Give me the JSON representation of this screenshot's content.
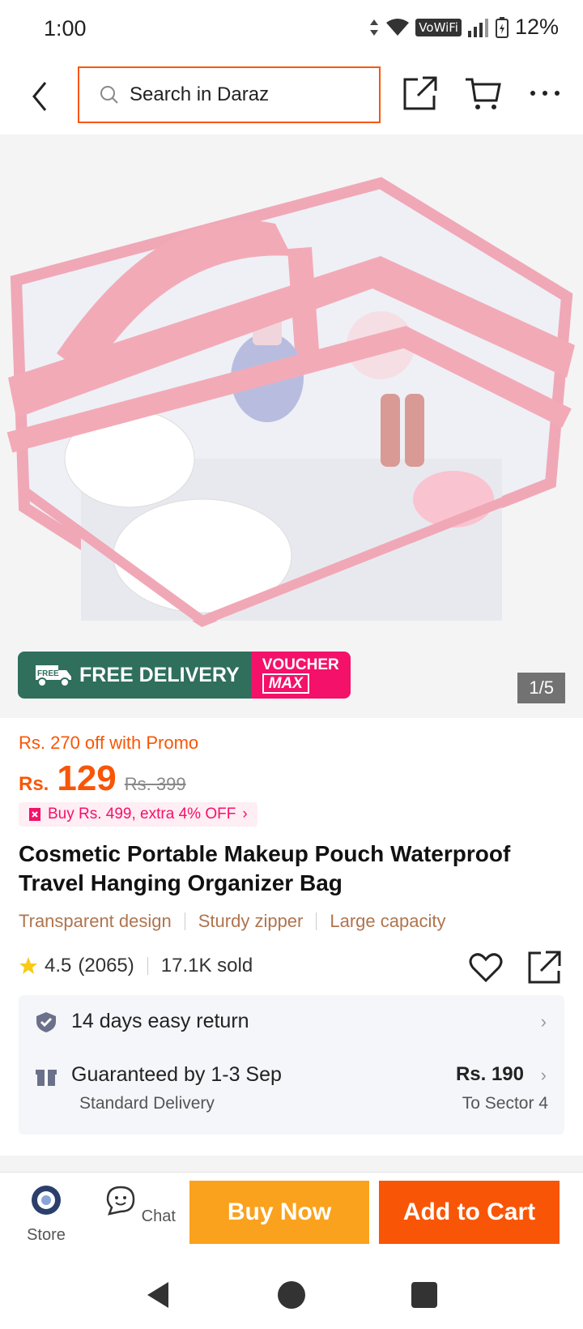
{
  "status": {
    "time": "1:00",
    "network_label": "VoWiFi",
    "battery": "12%"
  },
  "header": {
    "search_placeholder": "Search in Daraz"
  },
  "gallery": {
    "free_delivery_small": "FREE",
    "free_delivery": "FREE DELIVERY",
    "voucher_top": "VOUCHER",
    "voucher_bottom": "MAX",
    "counter": "1/5"
  },
  "product": {
    "promo": "Rs. 270 off with Promo",
    "currency": "Rs.",
    "price": "129",
    "old_price": "Rs. 399",
    "deal": "Buy Rs. 499, extra 4% OFF",
    "title": "Cosmetic Portable Makeup Pouch Waterproof Travel Hanging Organizer Bag",
    "features": [
      "Transparent design",
      "Sturdy zipper",
      "Large capacity"
    ],
    "rating": "4.5",
    "reviews": "(2065)",
    "sold": "17.1K sold"
  },
  "services": {
    "return_text": "14 days easy return",
    "delivery_title": "Guaranteed by 1-3 Sep",
    "delivery_sub": "Standard Delivery",
    "delivery_price": "Rs. 190",
    "delivery_dest": "To Sector 4"
  },
  "bottom_bar": {
    "store_label": "Store",
    "chat_label": "Chat",
    "buy_now": "Buy Now",
    "add_to_cart": "Add to Cart"
  },
  "colors": {
    "brand_orange": "#f85606",
    "buy_now_yellow": "#faa21d",
    "voucher_pink": "#f4116a",
    "free_delivery_green": "#2f6f5c"
  }
}
